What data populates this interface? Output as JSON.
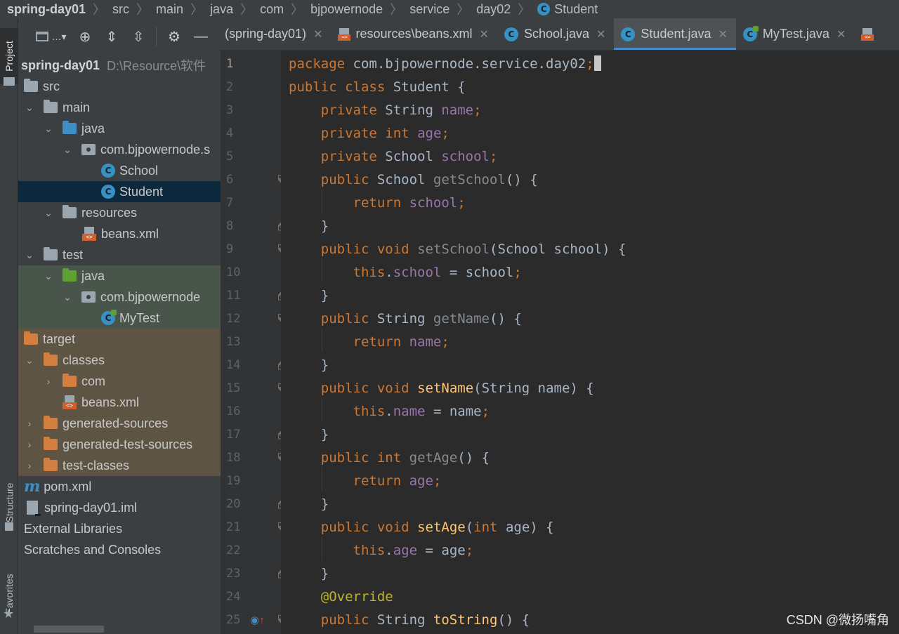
{
  "breadcrumb": {
    "items": [
      "spring-day01",
      "src",
      "main",
      "java",
      "com",
      "bjpowernode",
      "service",
      "day02",
      "Student"
    ]
  },
  "left_strip": {
    "project_tab": "Project",
    "structure_tab": "Structure",
    "favorites_tab": "Favorites"
  },
  "project_tree": {
    "root_name": "spring-day01",
    "root_path": "D:\\Resource\\软件",
    "src": "src",
    "main": "main",
    "java": "java",
    "package_main": "com.bjpowernode.s",
    "school": "School",
    "student": "Student",
    "resources": "resources",
    "beans_xml": "beans.xml",
    "test": "test",
    "test_java": "java",
    "package_test": "com.bjpowernode",
    "mytest": "MyTest",
    "target": "target",
    "classes": "classes",
    "com": "com",
    "target_beans_xml": "beans.xml",
    "generated_sources": "generated-sources",
    "generated_test_sources": "generated-test-sources",
    "test_classes": "test-classes",
    "pom": "pom.xml",
    "iml": "spring-day01.iml",
    "external_libraries": "External Libraries",
    "scratches": "Scratches and Consoles"
  },
  "tabs": [
    {
      "label": "(spring-day01)"
    },
    {
      "label": "resources\\beans.xml"
    },
    {
      "label": "School.java"
    },
    {
      "label": "Student.java"
    },
    {
      "label": "MyTest.java"
    }
  ],
  "code_lines": [
    "1",
    "2",
    "3",
    "4",
    "5",
    "6",
    "7",
    "8",
    "9",
    "10",
    "11",
    "12",
    "13",
    "14",
    "15",
    "16",
    "17",
    "18",
    "19",
    "20",
    "21",
    "22",
    "23",
    "24",
    "25"
  ],
  "code": {
    "l1_pkg": "package",
    "l1_name": " com.bjpowernode.service.day02",
    "l2_a": "public class",
    "l2_b": " Student {",
    "private": "private",
    "public": "public",
    "return": "return",
    "this": "this",
    "void": "void",
    "int": "int",
    "String": "String",
    "School": "School",
    "name": "name",
    "age": "age",
    "school": "school",
    "getSchool": "getSchool",
    "setSchool": "setSchool",
    "getName": "getName",
    "setName": "setName",
    "getAge": "getAge",
    "setAge": "setAge",
    "toString": "toString",
    "override": "@Override"
  },
  "watermark": "CSDN @微扬嘴角"
}
